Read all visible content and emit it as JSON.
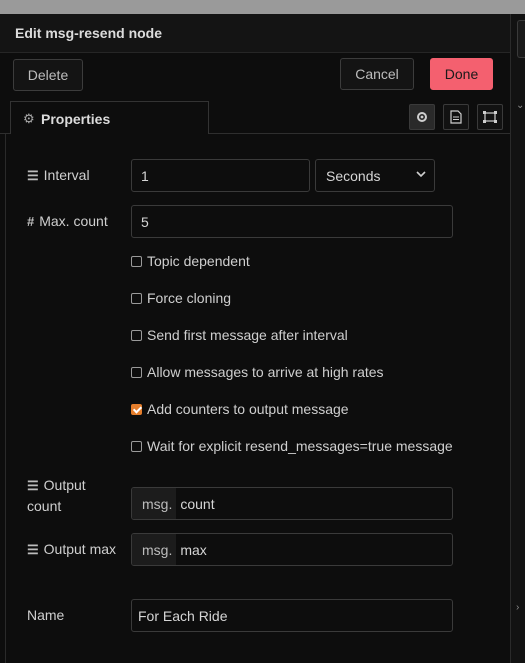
{
  "dialog": {
    "title": "Edit msg-resend node"
  },
  "buttons": {
    "delete": "Delete",
    "cancel": "Cancel",
    "done": "Done"
  },
  "tabs": {
    "properties": "Properties"
  },
  "tab_icons": [
    "gear-icon",
    "description-icon",
    "appearance-icon"
  ],
  "fields": {
    "interval": {
      "label": "Interval",
      "value": "1",
      "unit": "Seconds"
    },
    "max_count": {
      "label": "Max. count",
      "value": "5"
    },
    "output_count": {
      "label_line1": "Output",
      "label_line2": "count",
      "prefix": "msg.",
      "value": "count"
    },
    "output_max": {
      "label": "Output max",
      "prefix": "msg.",
      "value": "max"
    },
    "name": {
      "label": "Name",
      "value": "For Each Ride"
    }
  },
  "checkboxes": [
    {
      "label": "Topic dependent",
      "checked": false
    },
    {
      "label": "Force cloning",
      "checked": false
    },
    {
      "label": "Send first message after interval",
      "checked": false
    },
    {
      "label": "Allow messages to arrive at high rates",
      "checked": false
    },
    {
      "label": "Add counters to output message",
      "checked": true
    },
    {
      "label": "Wait for explicit resend_messages=true message",
      "checked": false
    }
  ],
  "colors": {
    "done": "#f4606f",
    "checkbox_checked": "#e57e2c",
    "background": "#0d0d0d"
  }
}
